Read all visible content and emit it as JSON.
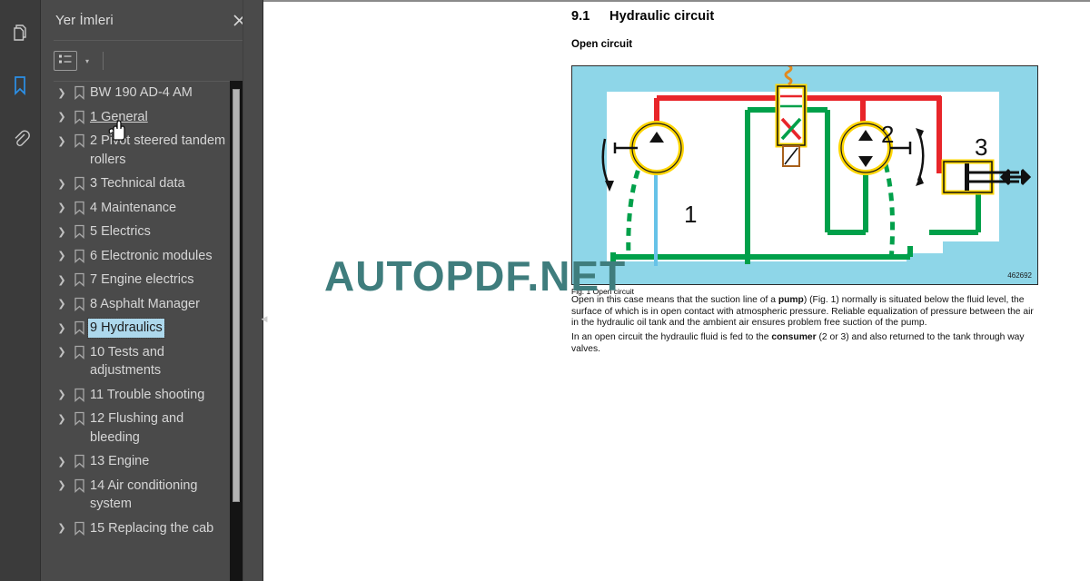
{
  "rail": {
    "items": [
      {
        "name": "page-thumbnails-icon",
        "label": "Sayfa Küçük Resimleri",
        "active": false
      },
      {
        "name": "bookmarks-icon",
        "label": "Yer İmleri",
        "active": true
      },
      {
        "name": "attachments-icon",
        "label": "Ekler",
        "active": false
      }
    ],
    "active_color": "#2b90e8"
  },
  "panel": {
    "title": "Yer İmleri",
    "close_label": "✕",
    "toolbar": {
      "options_icon": "list-options-icon",
      "caret": "▾"
    },
    "bookmarks": [
      {
        "label": "BW 190 AD-4 AM",
        "selected": false,
        "hovered": false
      },
      {
        "label": "1 General",
        "selected": false,
        "hovered": true
      },
      {
        "label": "2 Pivot steered tandem rollers",
        "selected": false,
        "hovered": false
      },
      {
        "label": "3 Technical data",
        "selected": false,
        "hovered": false
      },
      {
        "label": "4 Maintenance",
        "selected": false,
        "hovered": false
      },
      {
        "label": "5 Electrics",
        "selected": false,
        "hovered": false
      },
      {
        "label": "6 Electronic modules",
        "selected": false,
        "hovered": false
      },
      {
        "label": "7 Engine electrics",
        "selected": false,
        "hovered": false
      },
      {
        "label": "8 Asphalt Manager",
        "selected": false,
        "hovered": false
      },
      {
        "label": "9 Hydraulics",
        "selected": true,
        "hovered": false
      },
      {
        "label": "10 Tests and adjustments",
        "selected": false,
        "hovered": false
      },
      {
        "label": "11 Trouble shooting",
        "selected": false,
        "hovered": false
      },
      {
        "label": "12 Flushing and bleeding",
        "selected": false,
        "hovered": false
      },
      {
        "label": "13 Engine",
        "selected": false,
        "hovered": false
      },
      {
        "label": "14 Air conditioning system",
        "selected": false,
        "hovered": false
      },
      {
        "label": "15 Replacing the cab",
        "selected": false,
        "hovered": false
      }
    ],
    "expand_arrow": "❯",
    "selection_color": "#add8ec"
  },
  "document": {
    "heading_number": "9.1",
    "heading_title": "Hydraulic circuit",
    "subheading": "Open circuit",
    "figure": {
      "reference_number": "462692",
      "caption": "Fig. 1 Open circuit",
      "background_color": "#8ed6e8",
      "pressure_line_color": "#e8252a",
      "return_line_color": "#00a04a",
      "component_color": "#ffd500",
      "labels": [
        "1",
        "2",
        "3"
      ]
    },
    "paragraphs": [
      "Open in this case means that the suction line of a pump) (Fig. 1) normally is situated below the fluid level, the surface of which is in open contact with atmospheric pressure. Reliable equalization of pressure between the air in the hydraulic oil tank and the ambient air ensures problem free suction of the pump.",
      "In an open circuit the hydraulic fluid is fed to the consumer (2 or 3) and also returned to the tank through way valves."
    ]
  },
  "watermark": {
    "text": "AUTOPDF.NET",
    "color": "#3f7d7d"
  },
  "viewer": {
    "background_color": "#262626",
    "collapse_handle": "◀"
  }
}
